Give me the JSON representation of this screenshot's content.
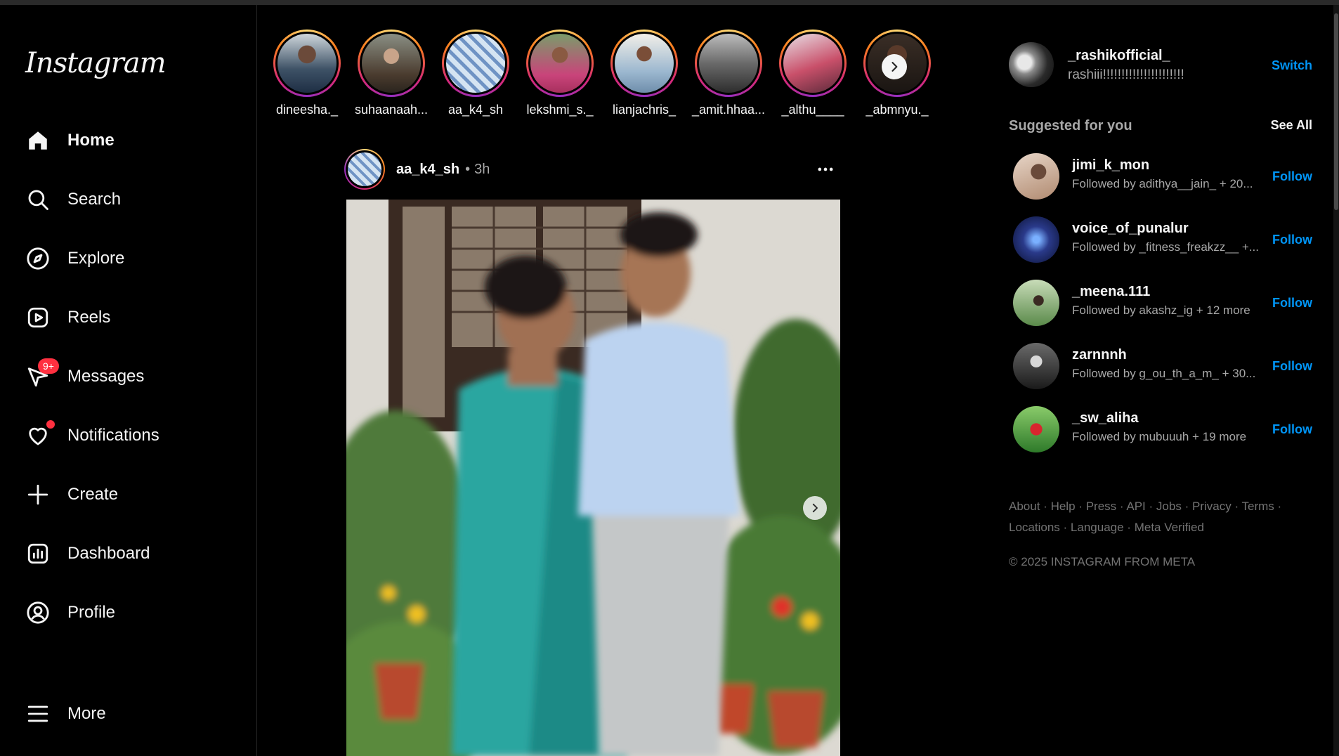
{
  "app": {
    "logo_text": "Instagram"
  },
  "nav": {
    "home": "Home",
    "search": "Search",
    "explore": "Explore",
    "reels": "Reels",
    "messages": "Messages",
    "messages_badge": "9+",
    "notifications": "Notifications",
    "create": "Create",
    "dashboard": "Dashboard",
    "profile": "Profile",
    "more": "More"
  },
  "stories": [
    {
      "name": "dineesha._"
    },
    {
      "name": "suhaanaah..."
    },
    {
      "name": "aa_k4_sh"
    },
    {
      "name": "lekshmi_s._"
    },
    {
      "name": "lianjachris_"
    },
    {
      "name": "_amit.hhaa..."
    },
    {
      "name": "_althu____"
    },
    {
      "name": "_abmnyu._"
    }
  ],
  "post": {
    "username": "aa_k4_sh",
    "separator": "•",
    "time": "3h"
  },
  "me": {
    "username": "_rashikofficial_",
    "name": "rashiii!!!!!!!!!!!!!!!!!!!!!!",
    "switch_label": "Switch"
  },
  "suggested": {
    "title": "Suggested for you",
    "see_all": "See All",
    "items": [
      {
        "username": "jimi_k_mon",
        "subtitle": "Followed by adithya__jain_ + 20...",
        "follow": "Follow"
      },
      {
        "username": "voice_of_punalur",
        "subtitle": "Followed by _fitness_freakzz__ +...",
        "follow": "Follow"
      },
      {
        "username": "_meena.111",
        "subtitle": "Followed by akashz_ig + 12 more",
        "follow": "Follow"
      },
      {
        "username": "zarnnnh",
        "subtitle": "Followed by g_ou_th_a_m_ + 30...",
        "follow": "Follow"
      },
      {
        "username": "_sw_aliha",
        "subtitle": "Followed by mubuuuh + 19 more",
        "follow": "Follow"
      }
    ]
  },
  "footer": {
    "links": [
      "About",
      "Help",
      "Press",
      "API",
      "Jobs",
      "Privacy",
      "Terms",
      "Locations",
      "Language",
      "Meta Verified"
    ],
    "sep": "·",
    "copyright": "© 2025 INSTAGRAM FROM META"
  },
  "colors": {
    "background": "#000000",
    "link_blue": "#0095f6",
    "muted": "#a8a8a8",
    "notification_red": "#ff3040"
  }
}
